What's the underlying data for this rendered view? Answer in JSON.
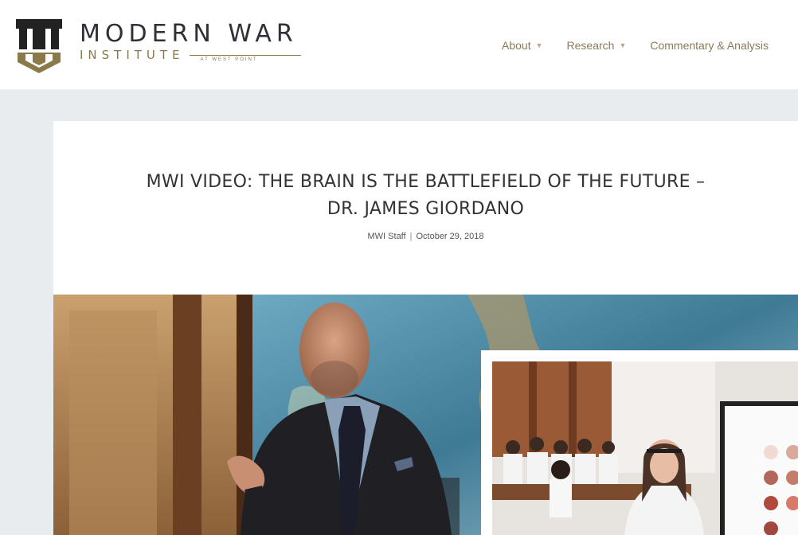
{
  "header": {
    "brand_line1": "MODERN WAR",
    "brand_line2": "INSTITUTE",
    "brand_sub": "AT WEST POINT",
    "nav": [
      {
        "label": "About"
      },
      {
        "label": "Research"
      },
      {
        "label": "Commentary & Analysis"
      }
    ]
  },
  "article": {
    "title_line1": "MWI VIDEO: THE BRAIN IS THE BATTLEFIELD OF THE FUTURE –",
    "title_line2": "DR. JAMES GIORDANO",
    "author": "MWI Staff",
    "separator": "|",
    "date": "October 29, 2018"
  },
  "colors": {
    "brand_dark": "#2e3138",
    "brand_gold": "#8a7a4a",
    "nav_text": "#8a7b57",
    "page_bg": "#e9ecef"
  },
  "icons": {
    "logo": "mwi-logo-icon",
    "chevron": "chevron-down-icon"
  }
}
